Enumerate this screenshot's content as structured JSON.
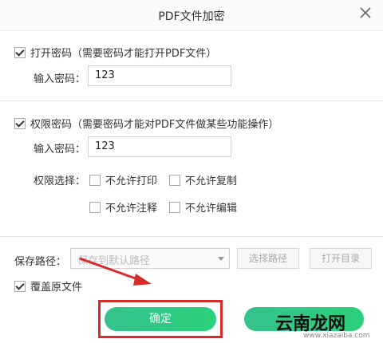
{
  "dialog": {
    "title": "PDF文件加密",
    "open_password": {
      "checked": true,
      "label": "打开密码（需要密码才能打开PDF文件）",
      "input_label": "输入密码：",
      "input_value": "123"
    },
    "permission_password": {
      "checked": true,
      "label": "权限密码（需要密码才能对PDF文件做某些功能操作）",
      "input_label": "输入密码：",
      "input_value": "123",
      "permissions_label": "权限选择：",
      "permissions": [
        {
          "label": "不允许打印",
          "checked": false
        },
        {
          "label": "不允许复制",
          "checked": false
        },
        {
          "label": "不允许注释",
          "checked": false
        },
        {
          "label": "不允许编辑",
          "checked": false
        }
      ]
    },
    "save": {
      "path_label": "保存路径：",
      "path_value": "保存到默认路径",
      "choose_path_label": "选择路径",
      "open_folder_label": "打开目录",
      "overwrite_label": "覆盖原文件",
      "overwrite_checked": true
    },
    "confirm_label": "确定"
  },
  "watermark": {
    "text": "云南龙网",
    "url": "www.xiazaiba.com"
  },
  "colors": {
    "primary": "#2ecc84",
    "annotation": "#d52b2b"
  }
}
